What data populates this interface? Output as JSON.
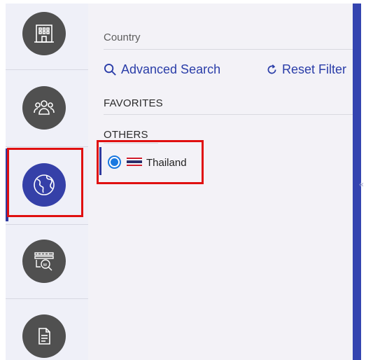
{
  "filter": {
    "country_label": "Country",
    "advanced_search_label": "Advanced Search",
    "reset_filter_label": "Reset Filter",
    "favorites_heading": "FAVORITES",
    "others_heading": "OTHERS",
    "countries": [
      {
        "name": "Thailand",
        "selected": true
      }
    ]
  },
  "rail": {
    "items": [
      {
        "icon": "building-icon"
      },
      {
        "icon": "people-icon"
      },
      {
        "icon": "globe-icon",
        "active": true
      },
      {
        "icon": "web-search-icon"
      },
      {
        "icon": "document-icon"
      }
    ]
  },
  "colors": {
    "accent": "#2f3a9f",
    "link": "#2a3da8",
    "radio": "#1a78e0",
    "highlight": "#e01010",
    "icon_circle": "#505050"
  }
}
